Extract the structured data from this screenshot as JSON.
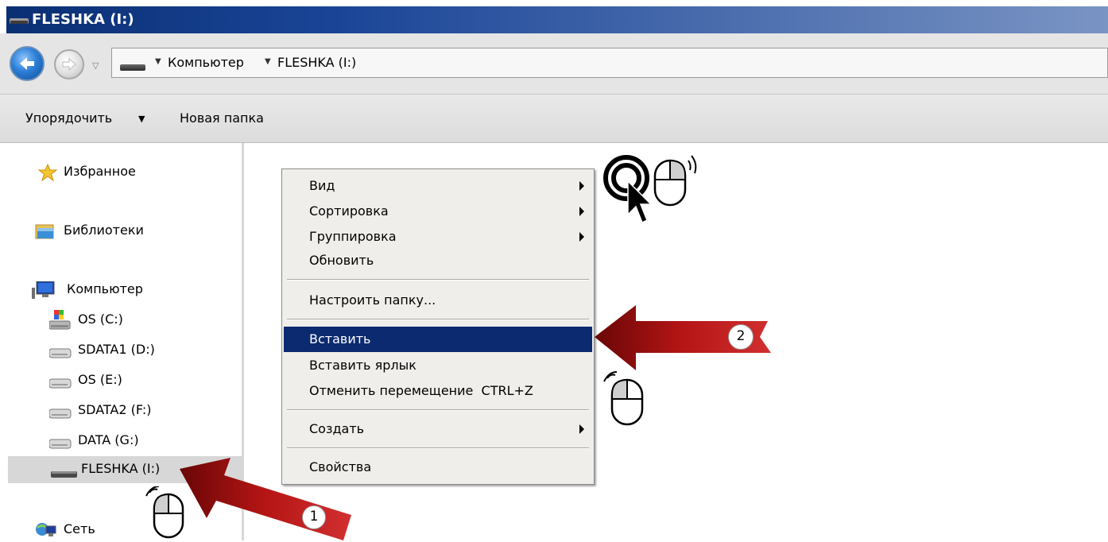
{
  "window": {
    "title": "FLESHKA (I:)"
  },
  "address_bar": {
    "crumbs": [
      "Компьютер",
      "FLESHKA (I:)"
    ]
  },
  "toolbar": {
    "organize_label": "Упорядочить",
    "new_folder_label": "Новая папка"
  },
  "nav_pane": {
    "favorites": "Избранное",
    "libraries": "Библиотеки",
    "computer": "Компьютер",
    "drives": [
      {
        "label": "OS (C:)",
        "icon": "system-drive-icon"
      },
      {
        "label": "SDATA1 (D:)",
        "icon": "hard-drive-icon"
      },
      {
        "label": "OS (E:)",
        "icon": "hard-drive-icon"
      },
      {
        "label": "SDATA2 (F:)",
        "icon": "hard-drive-icon"
      },
      {
        "label": "DATA (G:)",
        "icon": "hard-drive-icon"
      },
      {
        "label": "FLESHKA (I:)",
        "icon": "usb-drive-icon",
        "selected": true
      }
    ],
    "network": "Сеть"
  },
  "context_menu": {
    "items": [
      {
        "label": "Вид",
        "submenu": true
      },
      {
        "label": "Сортировка",
        "submenu": true
      },
      {
        "label": "Группировка",
        "submenu": true
      },
      {
        "label": "Обновить"
      },
      {
        "label": "Настроить папку..."
      },
      {
        "label": "Вставить",
        "highlighted": true
      },
      {
        "label": "Вставить ярлык"
      },
      {
        "label": "Отменить перемещение  CTRL+Z"
      },
      {
        "label": "Создать",
        "submenu": true
      },
      {
        "label": "Свойства"
      }
    ]
  },
  "annotations": {
    "step1": "1",
    "step2": "2",
    "arrow_color": "#a01010",
    "highlight_color": "#0b2a6f"
  }
}
